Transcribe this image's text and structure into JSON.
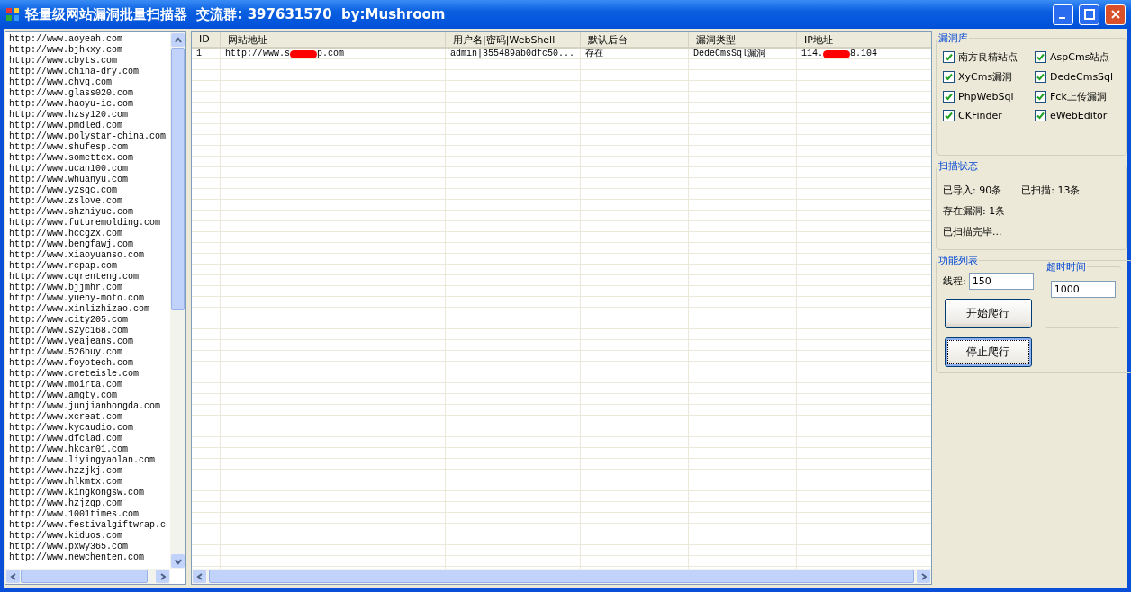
{
  "window": {
    "title": "轻量级网站漏洞批量扫描器  交流群: 397631570  by:Mushroom"
  },
  "url_list": [
    "http://www.aoyeah.com",
    "http://www.bjhkxy.com",
    "http://www.cbyts.com",
    "http://www.china-dry.com",
    "http://www.chvq.com",
    "http://www.glass020.com",
    "http://www.haoyu-ic.com",
    "http://www.hzsy120.com",
    "http://www.pmdled.com",
    "http://www.polystar-china.com",
    "http://www.shufesp.com",
    "http://www.somettex.com",
    "http://www.ucan100.com",
    "http://www.whuanyu.com",
    "http://www.yzsqc.com",
    "http://www.zslove.com",
    "http://www.shzhiyue.com",
    "http://www.futuremolding.com",
    "http://www.hccgzx.com",
    "http://www.bengfawj.com",
    "http://www.xiaoyuanso.com",
    "http://www.rcpap.com",
    "http://www.cqrenteng.com",
    "http://www.bjjmhr.com",
    "http://www.yueny-moto.com",
    "http://www.xinlizhizao.com",
    "http://www.city205.com",
    "http://www.szyc168.com",
    "http://www.yeajeans.com",
    "http://www.526buy.com",
    "http://www.foyotech.com",
    "http://www.creteisle.com",
    "http://www.moirta.com",
    "http://www.amgty.com",
    "http://www.junjianhongda.com",
    "http://www.xcreat.com",
    "http://www.kycaudio.com",
    "http://www.dfclad.com",
    "http://www.hkcar01.com",
    "http://www.liyingyaolan.com",
    "http://www.hzzjkj.com",
    "http://www.hlkmtx.com",
    "http://www.kingkongsw.com",
    "http://www.hzjzqp.com",
    "http://www.1001times.com",
    "http://www.festivalgiftwrap.c",
    "http://www.kiduos.com",
    "http://www.pxwy365.com",
    "http://www.newchenten.com"
  ],
  "table": {
    "columns": [
      "ID",
      "网站地址",
      "用户名|密码|WebShell",
      "默认后台",
      "漏洞类型",
      "IP地址"
    ],
    "rows": [
      {
        "cells": [
          {
            "text": "1"
          },
          {
            "text": "http://www.s",
            "redacted_after": "p.com"
          },
          {
            "text": "admin|355489ab0dfc50..."
          },
          {
            "text": "存在"
          },
          {
            "text": "DedeCmsSql漏洞"
          },
          {
            "text": "114.",
            "redacted_after": "8.104"
          }
        ]
      }
    ]
  },
  "vuln_library": {
    "title": "漏洞库",
    "items": [
      {
        "label": "南方良精站点",
        "checked": true
      },
      {
        "label": "AspCms站点",
        "checked": true
      },
      {
        "label": "XyCms漏洞",
        "checked": true
      },
      {
        "label": "DedeCmsSql",
        "checked": true
      },
      {
        "label": "PhpWebSql",
        "checked": true
      },
      {
        "label": "Fck上传漏洞",
        "checked": true
      },
      {
        "label": "CKFinder",
        "checked": true
      },
      {
        "label": "eWebEditor",
        "checked": true
      }
    ]
  },
  "scan_status": {
    "title": "扫描状态",
    "imported": "已导入: 90条",
    "scanned": "已扫描: 13条",
    "vulnerable": "存在漏洞: 1条",
    "message": "已扫描完毕..."
  },
  "functions": {
    "title": "功能列表",
    "threads_label": "线程:",
    "threads": "150",
    "timeout_title": "超时时间",
    "timeout": "1000",
    "buttons": [
      "开始爬行",
      "停止爬行"
    ]
  }
}
